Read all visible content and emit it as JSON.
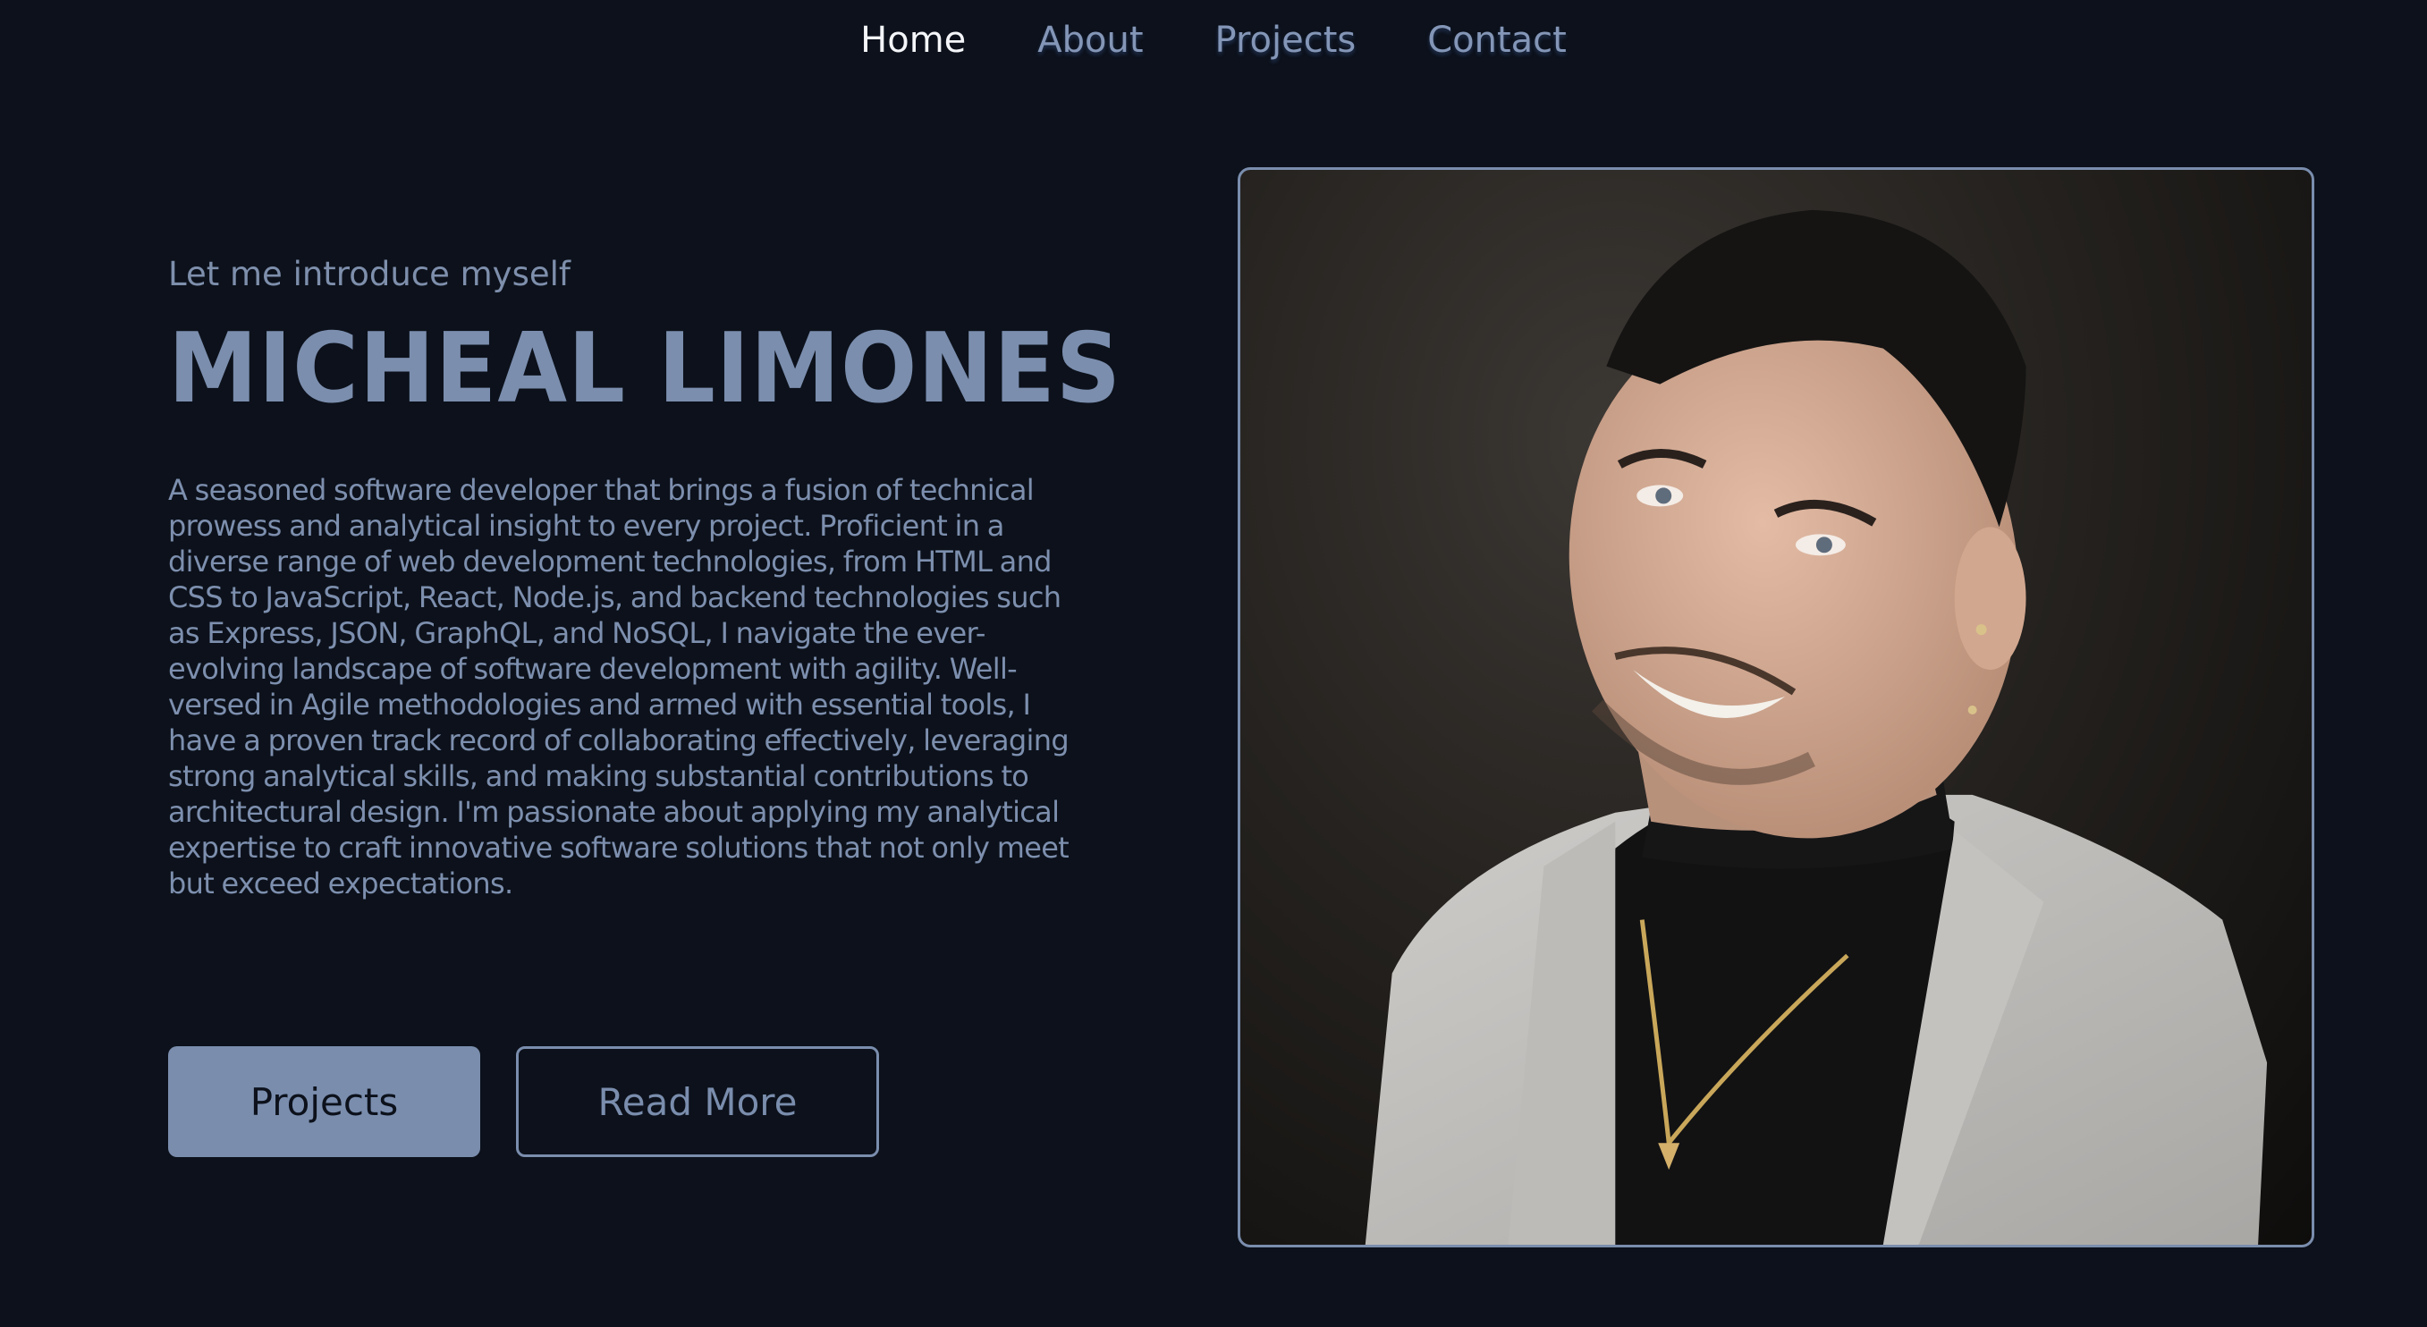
{
  "nav": {
    "items": [
      {
        "label": "Home",
        "active": true
      },
      {
        "label": "About",
        "active": false
      },
      {
        "label": "Projects",
        "active": false
      },
      {
        "label": "Contact",
        "active": false
      }
    ]
  },
  "hero": {
    "intro": "Let me introduce myself",
    "name": "MICHEAL LIMONES",
    "bio": "A seasoned software developer that brings a fusion of technical prowess and analytical insight to every project. Proficient in a diverse range of web development technologies, from HTML and CSS to JavaScript, React, Node.js, and backend technologies such as Express, JSON, GraphQL, and NoSQL, I navigate the ever-evolving landscape of software development with agility. Well-versed in Agile methodologies and armed with essential tools, I have a proven track record of collaborating effectively, leveraging strong analytical skills, and making substantial contributions to architectural design. I'm passionate about applying my analytical expertise to craft innovative software solutions that not only meet but exceed expectations.",
    "buttons": {
      "projects": "Projects",
      "read_more": "Read More"
    }
  },
  "colors": {
    "background": "#0c111b",
    "accent": "#7a8dad",
    "nav_active": "#f3f5f8"
  }
}
